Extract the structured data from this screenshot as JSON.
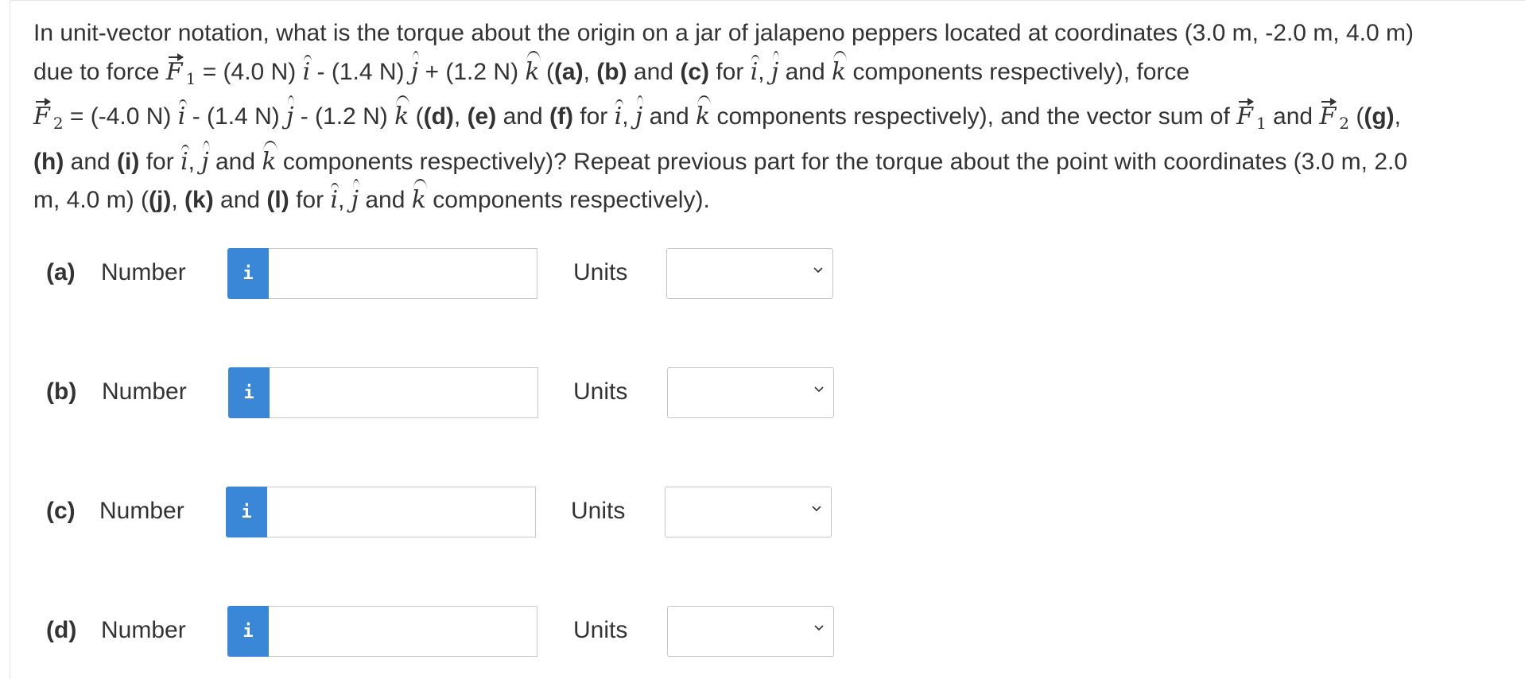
{
  "question": {
    "l1": "In unit-vector notation, what is the torque about the origin on a jar of jalapeno peppers located at coordinates (3.0 m, -2.0 m, 4.0 m)",
    "l2a": "due to force ",
    "F": "F",
    "one": "1",
    "two": "2",
    "l2b": " = (4.0 N) ",
    "i": "i",
    "j": "j",
    "k": "k",
    "l2c": " - (1.4 N) ",
    "l2d": " + (1.2 N) ",
    "l2e": " ((a), ",
    "pa": "(a)",
    "pb": "(b)",
    "pc": "(c)",
    "pd": "(d)",
    "pe": "(e)",
    "pf": "(f)",
    "pg": "(g)",
    "ph": "(h)",
    "pi": "(i)",
    "pj": "(j)",
    "pk": "(k)",
    "pl": "(l)",
    "and": " and ",
    "for": " for ",
    "comma": ", ",
    "comp": " components respectively), force",
    "l3b": " = (-4.0 N) ",
    "l3c": " - (1.4 N) ",
    "l3d": " - (1.2 N) ",
    "comp2": " components respectively), and the vector sum of ",
    "l4end": " components respectively)? Repeat previous part for the torque about the point with coordinates (3.0 m, 2.0",
    "l5a": "m, 4.0 m) (",
    "l5end": " components respectively)."
  },
  "parts": [
    {
      "label": "(a)",
      "number_label": "Number",
      "info_label": "i",
      "value": "",
      "units_label": "Units",
      "units_value": ""
    },
    {
      "label": "(b)",
      "number_label": "Number",
      "info_label": "i",
      "value": "",
      "units_label": "Units",
      "units_value": ""
    },
    {
      "label": "(c)",
      "number_label": "Number",
      "info_label": "i",
      "value": "",
      "units_label": "Units",
      "units_value": ""
    },
    {
      "label": "(d)",
      "number_label": "Number",
      "info_label": "i",
      "value": "",
      "units_label": "Units",
      "units_value": ""
    }
  ],
  "colors": {
    "info_button": "#3a87d8",
    "text": "#333333",
    "border": "#c8c8c8"
  },
  "icons": {
    "info": "info-icon",
    "dropdown": "chevron-down-icon"
  }
}
